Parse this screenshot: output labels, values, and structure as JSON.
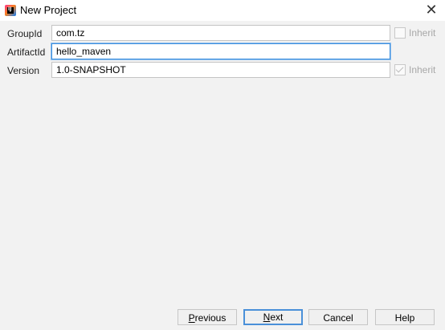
{
  "window": {
    "title": "New Project",
    "app_icon_letter": "IJ"
  },
  "form": {
    "group_id": {
      "label": "GroupId",
      "value": "com.tz",
      "inherit_label": "Inherit",
      "inherit_checked": false
    },
    "artifact_id": {
      "label": "ArtifactId",
      "value": "hello_maven"
    },
    "version": {
      "label": "Version",
      "value": "1.0-SNAPSHOT",
      "inherit_label": "Inherit",
      "inherit_checked": true
    }
  },
  "buttons": {
    "previous": {
      "mnemonic": "P",
      "rest": "revious"
    },
    "next": {
      "mnemonic": "N",
      "rest": "ext"
    },
    "cancel": "Cancel",
    "help": "Help"
  },
  "colors": {
    "focus_border": "#3c8fde",
    "default_button_border": "#4a90d9"
  }
}
